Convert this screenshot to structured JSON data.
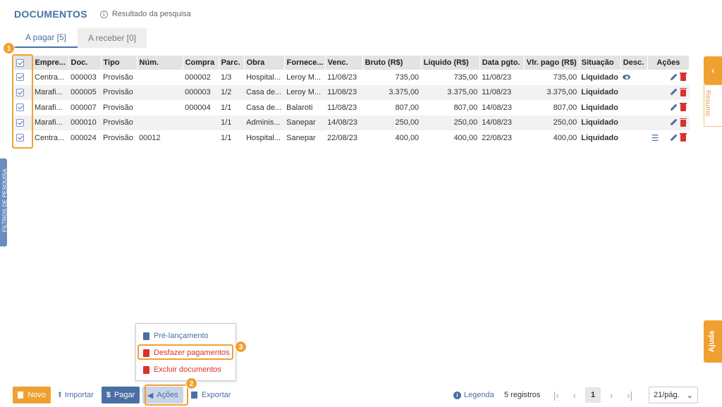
{
  "header": {
    "title": "DOCUMENTOS",
    "info": "Resultado da pesquisa"
  },
  "tabs": [
    {
      "label": "A pagar [5]",
      "active": true
    },
    {
      "label": "A receber [0]",
      "active": false
    }
  ],
  "table": {
    "columns": [
      "Empre...",
      "Doc.",
      "Tipo",
      "Núm.",
      "Compra",
      "Parc.",
      "Obra",
      "Fornece...",
      "Venc.",
      "Bruto (R$)",
      "Líquido (R$)",
      "Data pgto.",
      "Vlr. pago (R$)",
      "Situação",
      "Desc.",
      "Ações"
    ],
    "rows": [
      {
        "empresa": "Centra...",
        "doc": "000003",
        "tipo": "Provisão",
        "num": "",
        "compra": "000002",
        "parc": "1/3",
        "obra": "Hospital...",
        "fornecedor": "Leroy M...",
        "venc": "11/08/23",
        "bruto": "735,00",
        "liquido": "735,00",
        "data_pgto": "11/08/23",
        "vlr_pago": "735,00",
        "situacao": "Liquidado",
        "desc_icon": "eye-icon"
      },
      {
        "empresa": "Marafi...",
        "doc": "000005",
        "tipo": "Provisão",
        "num": "",
        "compra": "000003",
        "parc": "1/2",
        "obra": "Casa de...",
        "fornecedor": "Leroy M...",
        "venc": "11/08/23",
        "bruto": "3.375,00",
        "liquido": "3.375,00",
        "data_pgto": "11/08/23",
        "vlr_pago": "3.375,00",
        "situacao": "Liquidado",
        "desc_icon": ""
      },
      {
        "empresa": "Marafi...",
        "doc": "000007",
        "tipo": "Provisão",
        "num": "",
        "compra": "000004",
        "parc": "1/1",
        "obra": "Casa de...",
        "fornecedor": "Balaroti",
        "venc": "11/08/23",
        "bruto": "807,00",
        "liquido": "807,00",
        "data_pgto": "14/08/23",
        "vlr_pago": "807,00",
        "situacao": "Liquidado",
        "desc_icon": ""
      },
      {
        "empresa": "Marafi...",
        "doc": "000010",
        "tipo": "Provisão",
        "num": "",
        "compra": "",
        "parc": "1/1",
        "obra": "Adminis...",
        "fornecedor": "Sanepar",
        "venc": "14/08/23",
        "bruto": "250,00",
        "liquido": "250,00",
        "data_pgto": "14/08/23",
        "vlr_pago": "250,00",
        "situacao": "Liquidado",
        "desc_icon": ""
      },
      {
        "empresa": "Centra...",
        "doc": "000024",
        "tipo": "Provisão",
        "num": "00012",
        "compra": "",
        "parc": "1/1",
        "obra": "Hospital...",
        "fornecedor": "Sanepar",
        "venc": "22/08/23",
        "bruto": "400,00",
        "liquido": "400,00",
        "data_pgto": "22/08/23",
        "vlr_pago": "400,00",
        "situacao": "Liquidado",
        "desc_icon": ""
      }
    ]
  },
  "dropdown": {
    "items": [
      "Pré-lançamento",
      "Desfazer pagamentos",
      "Excluir documentos"
    ]
  },
  "toolbar": {
    "novo": "Novo",
    "importar": "Importar",
    "pagar": "Pagar",
    "acoes": "Ações",
    "exportar": "Exportar"
  },
  "pagination": {
    "legenda": "Legenda",
    "registros": "5 registros",
    "current_page": "1",
    "per_page": "21/pág."
  },
  "side": {
    "filtros": "FILTROS DE PESQUISA",
    "resumo": "Resumo",
    "ajuda": "Ajuda"
  },
  "callouts": [
    "1",
    "2",
    "3"
  ],
  "colors": {
    "accent": "#4a6fa5",
    "orange": "#f0a030",
    "success": "#2e9e2e",
    "danger": "#d9312c"
  }
}
